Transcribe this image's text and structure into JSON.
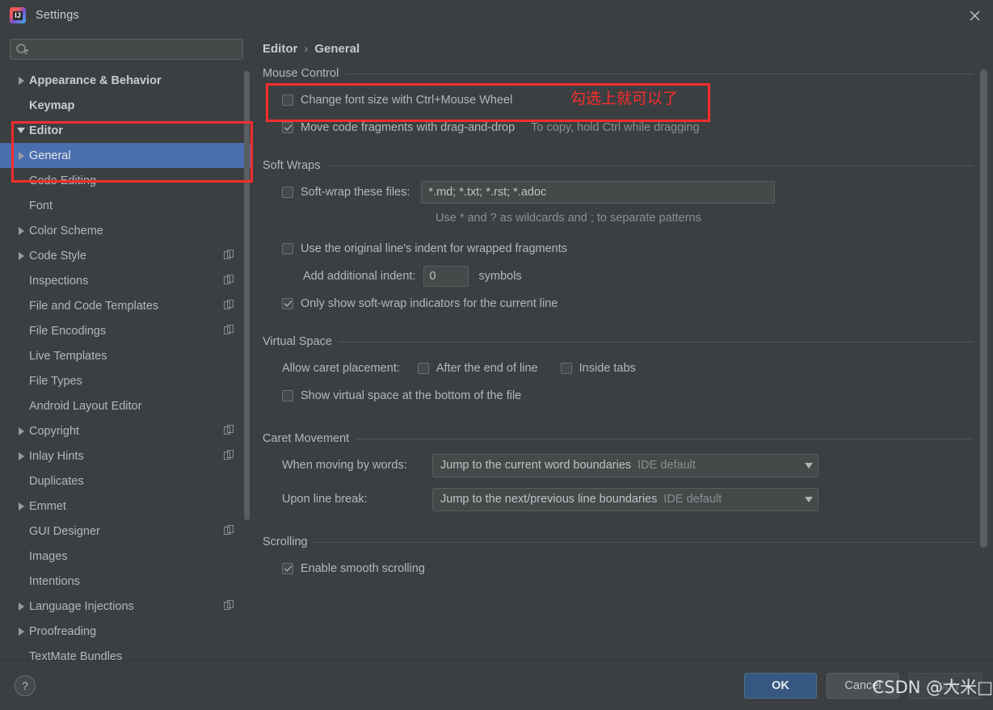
{
  "window": {
    "title": "Settings",
    "logo_text": "IJ",
    "close_label": "×"
  },
  "search": {
    "value": "",
    "placeholder": ""
  },
  "sidebar": {
    "items": [
      {
        "label": "Appearance & Behavior",
        "indent": 0,
        "arrow": "right",
        "bold": true,
        "selected": false,
        "copy": false
      },
      {
        "label": "Keymap",
        "indent": 0,
        "arrow": "none",
        "bold": true,
        "selected": false,
        "copy": false
      },
      {
        "label": "Editor",
        "indent": 0,
        "arrow": "down",
        "bold": true,
        "selected": false,
        "copy": false
      },
      {
        "label": "General",
        "indent": 1,
        "arrow": "right",
        "bold": false,
        "selected": true,
        "copy": false
      },
      {
        "label": "Code Editing",
        "indent": 1,
        "arrow": "none",
        "bold": false,
        "selected": false,
        "copy": false
      },
      {
        "label": "Font",
        "indent": 1,
        "arrow": "none",
        "bold": false,
        "selected": false,
        "copy": false
      },
      {
        "label": "Color Scheme",
        "indent": 1,
        "arrow": "right",
        "bold": false,
        "selected": false,
        "copy": false
      },
      {
        "label": "Code Style",
        "indent": 1,
        "arrow": "right",
        "bold": false,
        "selected": false,
        "copy": true
      },
      {
        "label": "Inspections",
        "indent": 1,
        "arrow": "none",
        "bold": false,
        "selected": false,
        "copy": true
      },
      {
        "label": "File and Code Templates",
        "indent": 1,
        "arrow": "none",
        "bold": false,
        "selected": false,
        "copy": true
      },
      {
        "label": "File Encodings",
        "indent": 1,
        "arrow": "none",
        "bold": false,
        "selected": false,
        "copy": true
      },
      {
        "label": "Live Templates",
        "indent": 1,
        "arrow": "none",
        "bold": false,
        "selected": false,
        "copy": false
      },
      {
        "label": "File Types",
        "indent": 1,
        "arrow": "none",
        "bold": false,
        "selected": false,
        "copy": false
      },
      {
        "label": "Android Layout Editor",
        "indent": 1,
        "arrow": "none",
        "bold": false,
        "selected": false,
        "copy": false
      },
      {
        "label": "Copyright",
        "indent": 1,
        "arrow": "right",
        "bold": false,
        "selected": false,
        "copy": true
      },
      {
        "label": "Inlay Hints",
        "indent": 1,
        "arrow": "right",
        "bold": false,
        "selected": false,
        "copy": true
      },
      {
        "label": "Duplicates",
        "indent": 1,
        "arrow": "none",
        "bold": false,
        "selected": false,
        "copy": false
      },
      {
        "label": "Emmet",
        "indent": 1,
        "arrow": "right",
        "bold": false,
        "selected": false,
        "copy": false
      },
      {
        "label": "GUI Designer",
        "indent": 1,
        "arrow": "none",
        "bold": false,
        "selected": false,
        "copy": true
      },
      {
        "label": "Images",
        "indent": 1,
        "arrow": "none",
        "bold": false,
        "selected": false,
        "copy": false
      },
      {
        "label": "Intentions",
        "indent": 1,
        "arrow": "none",
        "bold": false,
        "selected": false,
        "copy": false
      },
      {
        "label": "Language Injections",
        "indent": 1,
        "arrow": "right",
        "bold": false,
        "selected": false,
        "copy": true
      },
      {
        "label": "Proofreading",
        "indent": 1,
        "arrow": "right",
        "bold": false,
        "selected": false,
        "copy": false
      },
      {
        "label": "TextMate Bundles",
        "indent": 1,
        "arrow": "none",
        "bold": false,
        "selected": false,
        "copy": false
      }
    ]
  },
  "breadcrumb": {
    "parent": "Editor",
    "separator": "›",
    "current": "General"
  },
  "mouse_control": {
    "title": "Mouse Control",
    "change_font_size": {
      "label": "Change font size with Ctrl+Mouse Wheel",
      "checked": false
    },
    "move_fragments": {
      "label": "Move code fragments with drag-and-drop",
      "checked": true,
      "hint": "To copy, hold Ctrl while dragging"
    }
  },
  "soft_wraps": {
    "title": "Soft Wraps",
    "soft_wrap_files": {
      "label": "Soft-wrap these files:",
      "checked": false,
      "value": "*.md; *.txt; *.rst; *.adoc"
    },
    "wildcard_hint": "Use * and ? as wildcards and ; to separate patterns",
    "original_indent": {
      "label": "Use the original line's indent for wrapped fragments",
      "checked": false
    },
    "additional_indent": {
      "label": "Add additional indent:",
      "value": "0",
      "suffix": "symbols"
    },
    "only_show_indicators": {
      "label": "Only show soft-wrap indicators for the current line",
      "checked": true
    }
  },
  "virtual_space": {
    "title": "Virtual Space",
    "allow_caret_label": "Allow caret placement:",
    "after_end_of_line": {
      "label": "After the end of line",
      "checked": false
    },
    "inside_tabs": {
      "label": "Inside tabs",
      "checked": false
    },
    "show_virtual_space": {
      "label": "Show virtual space at the bottom of the file",
      "checked": false
    }
  },
  "caret_movement": {
    "title": "Caret Movement",
    "when_moving_by_words": {
      "label": "When moving by words:",
      "value": "Jump to the current word boundaries",
      "default_tag": "IDE default"
    },
    "upon_line_break": {
      "label": "Upon line break:",
      "value": "Jump to the next/previous line boundaries",
      "default_tag": "IDE default"
    }
  },
  "scrolling": {
    "title": "Scrolling",
    "enable_smooth": {
      "label": "Enable smooth scrolling",
      "checked": true
    }
  },
  "footer": {
    "help_label": "?",
    "ok_label": "OK",
    "cancel_label": "Cancel",
    "apply_label": "Apply"
  },
  "annotations": {
    "note_text": "勾选上就可以了",
    "note_color": "#fa2c2c",
    "watermark": "CSDN @大米□"
  },
  "colors": {
    "background": "#3c3f41",
    "selection": "#4b6eaf",
    "accent_button": "#365880",
    "annotation_red": "#fa2c2c"
  }
}
